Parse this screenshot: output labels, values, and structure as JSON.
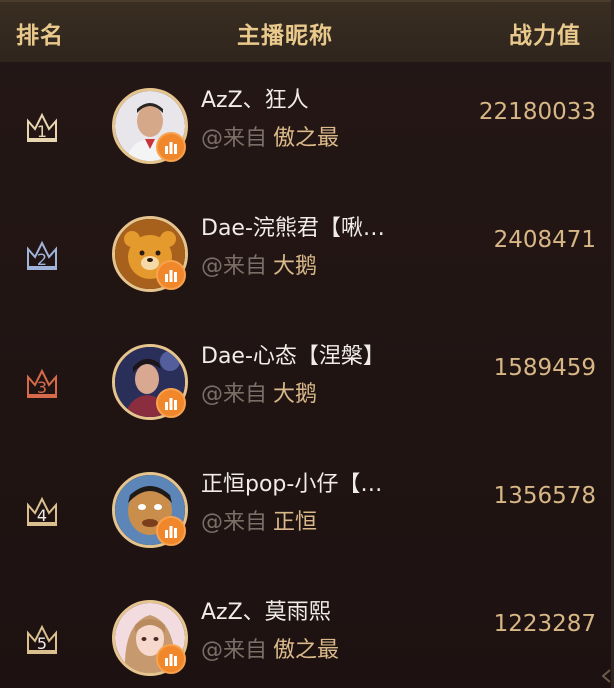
{
  "header": {
    "rank_label": "排名",
    "name_label": "主播昵称",
    "power_label": "战力值"
  },
  "colors": {
    "gold": "#e9c98c",
    "rank1": "#e8d6b0",
    "rank2": "#9fb4d8",
    "rank3": "#d66a4a",
    "rank_default": "#d9c08e",
    "badge": "#f0872a"
  },
  "rows": [
    {
      "rank": "1",
      "crown_icon": "crown-icon",
      "name": "AzZ、狂人",
      "source_prefix": "@来自",
      "team": "傲之最",
      "power": "22180033",
      "avatar": "avatar-photo-man"
    },
    {
      "rank": "2",
      "crown_icon": "crown-icon",
      "name": "Dae-浣熊君【啾…",
      "source_prefix": "@来自",
      "team": "大鹅",
      "power": "2408471",
      "avatar": "avatar-bear"
    },
    {
      "rank": "3",
      "crown_icon": "crown-icon",
      "name": "Dae-心态【涅槃】",
      "source_prefix": "@来自",
      "team": "大鹅",
      "power": "1589459",
      "avatar": "avatar-photo-youth"
    },
    {
      "rank": "4",
      "crown_icon": "crown-icon",
      "name": "正恒pop-小仔【…",
      "source_prefix": "@来自",
      "team": "正恒",
      "power": "1356578",
      "avatar": "avatar-cartoon"
    },
    {
      "rank": "5",
      "crown_icon": "crown-icon",
      "name": "AzZ、莫雨熙",
      "source_prefix": "@来自",
      "team": "傲之最",
      "power": "1223287",
      "avatar": "avatar-photo-girl"
    }
  ]
}
